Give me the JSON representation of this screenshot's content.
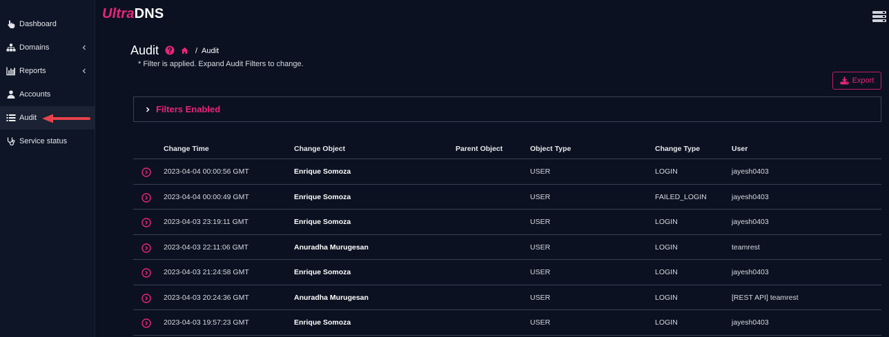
{
  "app": {
    "logo_prefix": "Ultra",
    "logo_suffix": "DNS"
  },
  "sidebar": {
    "items": [
      {
        "label": "Dashboard",
        "icon": "hand-pointer-icon",
        "active": false
      },
      {
        "label": "Domains",
        "icon": "sitemap-icon",
        "has_chevron": true
      },
      {
        "label": "Reports",
        "icon": "bar-chart-icon",
        "has_chevron": true
      },
      {
        "label": "Accounts",
        "icon": "user-icon"
      },
      {
        "label": "Audit",
        "icon": "list-icon",
        "active": true
      },
      {
        "label": "Service status",
        "icon": "stethoscope-icon"
      }
    ]
  },
  "page": {
    "title": "Audit",
    "breadcrumb_separator": "/",
    "breadcrumb_current": "Audit",
    "filter_note": "* Filter is applied. Expand Audit Filters to change.",
    "export_label": "Export",
    "filters_title": "Filters Enabled"
  },
  "table": {
    "headers": {
      "change_time": "Change Time",
      "change_object": "Change Object",
      "parent_object": "Parent Object",
      "object_type": "Object Type",
      "change_type": "Change Type",
      "user": "User"
    },
    "rows": [
      {
        "change_time": "2023-04-04 00:00:56 GMT",
        "change_object": "Enrique Somoza",
        "parent_object": "",
        "object_type": "USER",
        "change_type": "LOGIN",
        "user": "jayesh0403"
      },
      {
        "change_time": "2023-04-04 00:00:49 GMT",
        "change_object": "Enrique Somoza",
        "parent_object": "",
        "object_type": "USER",
        "change_type": "FAILED_LOGIN",
        "user": "jayesh0403"
      },
      {
        "change_time": "2023-04-03 23:19:11 GMT",
        "change_object": "Enrique Somoza",
        "parent_object": "",
        "object_type": "USER",
        "change_type": "LOGIN",
        "user": "jayesh0403"
      },
      {
        "change_time": "2023-04-03 22:11:06 GMT",
        "change_object": "Anuradha Murugesan",
        "parent_object": "",
        "object_type": "USER",
        "change_type": "LOGIN",
        "user": "teamrest"
      },
      {
        "change_time": "2023-04-03 21:24:58 GMT",
        "change_object": "Enrique Somoza",
        "parent_object": "",
        "object_type": "USER",
        "change_type": "LOGIN",
        "user": "jayesh0403"
      },
      {
        "change_time": "2023-04-03 20:24:36 GMT",
        "change_object": "Anuradha Murugesan",
        "parent_object": "",
        "object_type": "USER",
        "change_type": "LOGIN",
        "user": "[REST API] teamrest"
      },
      {
        "change_time": "2023-04-03 19:57:23 GMT",
        "change_object": "Enrique Somoza",
        "parent_object": "",
        "object_type": "USER",
        "change_type": "LOGIN",
        "user": "jayesh0403"
      }
    ]
  },
  "colors": {
    "background": "#0b1120",
    "sidebar": "#0e1526",
    "accent": "#e8257a",
    "arrow": "#e8434a"
  }
}
